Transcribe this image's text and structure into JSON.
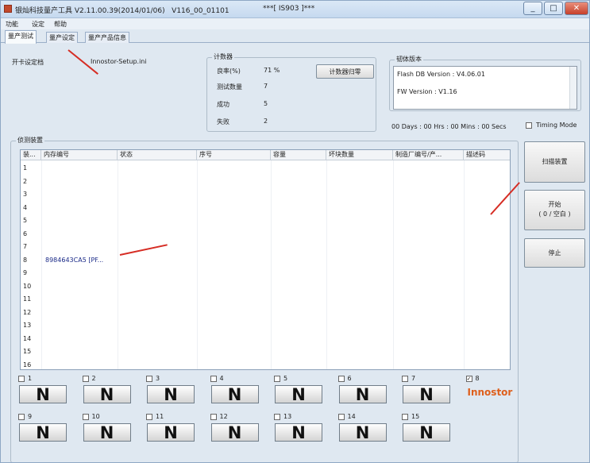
{
  "title": {
    "app": "银灿科技量产工具 V2.11.00.39(2014/01/06)   V116_00_01101",
    "center": "***[ IS903 ]***",
    "min": "_",
    "max": "□",
    "close": "✕"
  },
  "menu": [
    "功能",
    "设定",
    "帮助"
  ],
  "tabs": [
    "量产测试",
    "量产设定",
    "量产产品信息"
  ],
  "settings": {
    "label": "开卡设定档",
    "value": "Innostor-Setup.ini"
  },
  "counter": {
    "title": "计数器",
    "reset_button": "计数器归零",
    "rows": [
      {
        "label": "良率(%)",
        "value": "71 %"
      },
      {
        "label": "测试数量",
        "value": "7"
      },
      {
        "label": "成功",
        "value": "5"
      },
      {
        "label": "失败",
        "value": "2"
      }
    ]
  },
  "firmware": {
    "title": "韧体版本",
    "flash_db": "Flash DB Version :  V4.06.01",
    "fw": "FW Version :   V1.16"
  },
  "timer": {
    "text": "00 Days : 00 Hrs : 00 Mins : 00 Secs",
    "timing_mode_label": "Timing Mode"
  },
  "devices": {
    "title": "侦测装置",
    "headers": [
      "装...",
      "内存编号",
      "状态",
      "序号",
      "容量",
      "坏块数量",
      "制造厂编号/产...",
      "描述码"
    ],
    "rows": [
      "1",
      "2",
      "3",
      "4",
      "5",
      "6",
      "7",
      "8",
      "9",
      "10",
      "11",
      "12",
      "13",
      "14",
      "15",
      "16"
    ],
    "row8_memory": "8984643CA5 [PF..."
  },
  "buttons": {
    "rescan": "扫描装置",
    "start": "开始\n( 0 / 空白 )",
    "stop": "停止"
  },
  "slots": [
    {
      "num": "1",
      "checked": false,
      "text": "N"
    },
    {
      "num": "2",
      "checked": false,
      "text": "N"
    },
    {
      "num": "3",
      "checked": false,
      "text": "N"
    },
    {
      "num": "4",
      "checked": false,
      "text": "N"
    },
    {
      "num": "5",
      "checked": false,
      "text": "N"
    },
    {
      "num": "6",
      "checked": false,
      "text": "N"
    },
    {
      "num": "7",
      "checked": false,
      "text": "N"
    },
    {
      "num": "8",
      "checked": true,
      "text": "Innostor"
    },
    {
      "num": "9",
      "checked": false,
      "text": "N"
    },
    {
      "num": "10",
      "checked": false,
      "text": "N"
    },
    {
      "num": "11",
      "checked": false,
      "text": "N"
    },
    {
      "num": "12",
      "checked": false,
      "text": "N"
    },
    {
      "num": "13",
      "checked": false,
      "text": "N"
    },
    {
      "num": "14",
      "checked": false,
      "text": "N"
    },
    {
      "num": "15",
      "checked": false,
      "text": "N"
    }
  ],
  "colors": {
    "arrow": "#d62d24",
    "innostor": "#de5f1c"
  }
}
